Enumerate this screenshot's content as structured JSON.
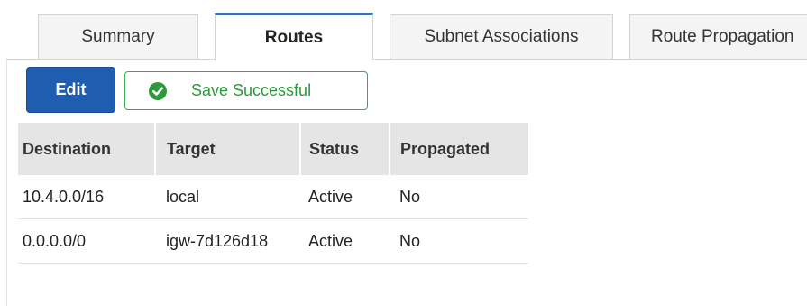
{
  "tabs": [
    {
      "label": "Summary",
      "active": false
    },
    {
      "label": "Routes",
      "active": true
    },
    {
      "label": "Subnet Associations",
      "active": false
    },
    {
      "label": "Route Propagation",
      "active": false
    }
  ],
  "toolbar": {
    "edit_label": "Edit",
    "save_message": "Save Successful"
  },
  "table": {
    "columns": [
      "Destination",
      "Target",
      "Status",
      "Propagated"
    ],
    "rows": [
      {
        "destination": "10.4.0.0/16",
        "target": "local",
        "target_is_link": false,
        "status": "Active",
        "propagated": "No"
      },
      {
        "destination": "0.0.0.0/0",
        "target": "igw-7d126d18",
        "target_is_link": true,
        "status": "Active",
        "propagated": "No"
      }
    ]
  },
  "colors": {
    "primary_button": "#1f5db0",
    "active_tab_accent": "#3a6fb0",
    "success": "#2a9a3a",
    "link": "#2a6aa5",
    "header_bg": "#e5e5e5"
  },
  "icons": {
    "save_status": "check-circle-icon"
  }
}
